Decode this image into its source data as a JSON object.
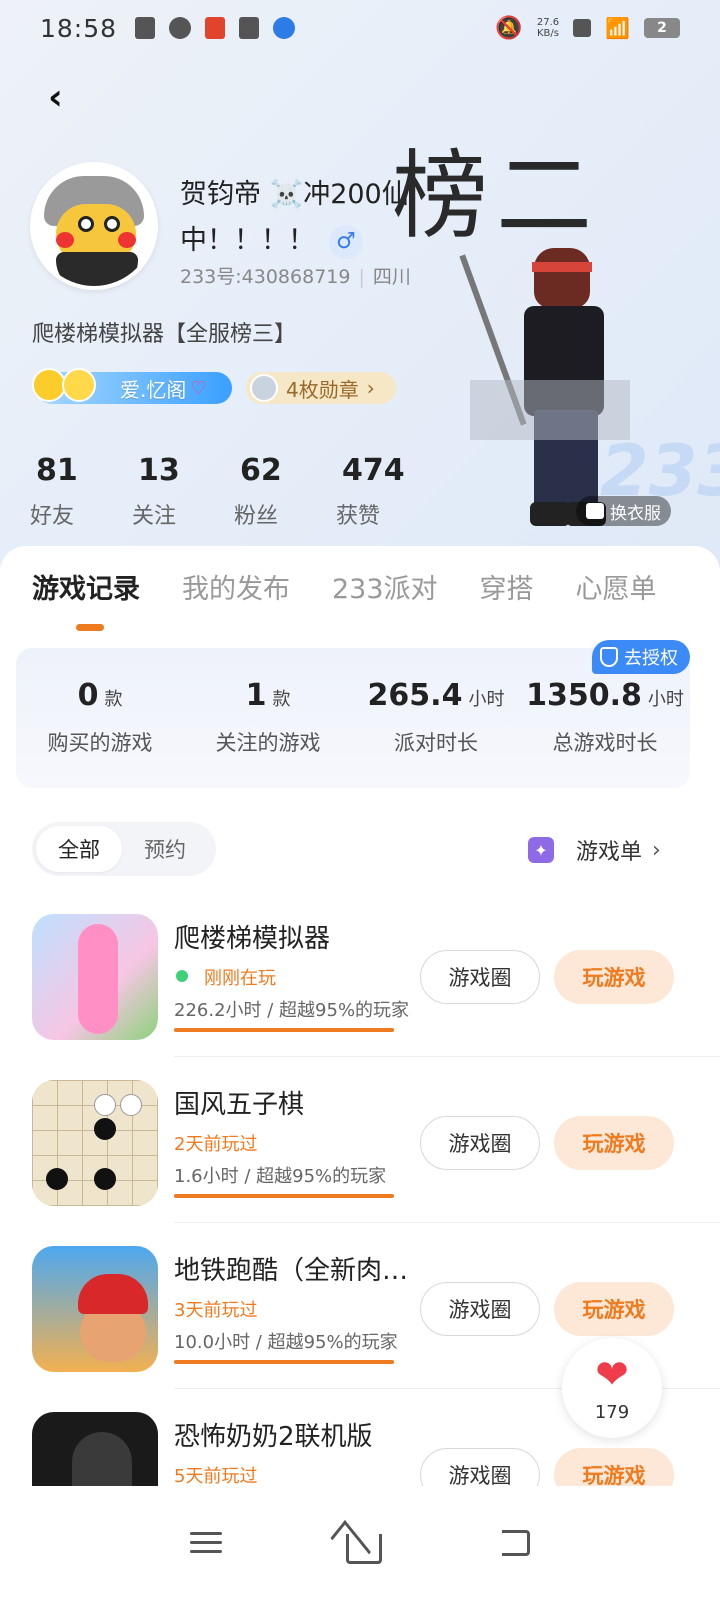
{
  "status_bar": {
    "time": "18:58",
    "net_speed_value": "27.6",
    "net_speed_unit": "KB/s",
    "battery": "2",
    "icons": [
      "sim-icon",
      "app-icon",
      "app-icon",
      "battery-icon",
      "telecom-icon",
      "mute-icon",
      "wifi-icon"
    ]
  },
  "profile": {
    "name": "贺钧帝 ☠️冲200仙中！！！！",
    "gender_symbol": "♂",
    "uid": "233号:430868719",
    "location": "四川",
    "big_overlay_text": "榜二",
    "bio": "爬楼梯模拟器【全服榜三】",
    "tag_label": "爱.忆阁",
    "tag_suffix": "♡",
    "medal_label": "4枚勋章",
    "stats": [
      {
        "value": "81",
        "label": "好友"
      },
      {
        "value": "13",
        "label": "关注"
      },
      {
        "value": "62",
        "label": "粉丝"
      },
      {
        "value": "474",
        "label": "获赞"
      }
    ],
    "change_outfit_label": "换衣服",
    "watermark_233": "233"
  },
  "tabs": [
    {
      "label": "游戏记录",
      "active": true
    },
    {
      "label": "我的发布",
      "active": false
    },
    {
      "label": "233派对",
      "active": false
    },
    {
      "label": "穿搭",
      "active": false
    },
    {
      "label": "心愿单",
      "active": false
    }
  ],
  "summary": {
    "auth_label": "去授权",
    "items": [
      {
        "value": "0",
        "unit": "款",
        "label": "购买的游戏"
      },
      {
        "value": "1",
        "unit": "款",
        "label": "关注的游戏"
      },
      {
        "value": "265.4",
        "unit": "小时",
        "label": "派对时长"
      },
      {
        "value": "1350.8",
        "unit": "小时",
        "label": "总游戏时长"
      }
    ]
  },
  "filters": [
    {
      "label": "全部",
      "active": true
    },
    {
      "label": "预约",
      "active": false
    }
  ],
  "gamelist_label": "游戏单",
  "games": [
    {
      "name": "爬楼梯模拟器",
      "status": "刚刚在玩",
      "live": true,
      "meta": "226.2小时 / 超越95%的玩家",
      "circle_label": "游戏圈",
      "play_label": "玩游戏"
    },
    {
      "name": "国风五子棋",
      "status": "2天前玩过",
      "live": false,
      "meta": "1.6小时 / 超越95%的玩家",
      "circle_label": "游戏圈",
      "play_label": "玩游戏"
    },
    {
      "name": "地铁跑酷（全新肉…",
      "status": "3天前玩过",
      "live": false,
      "meta": "10.0小时 / 超越95%的玩家",
      "circle_label": "游戏圈",
      "play_label": "玩游戏"
    },
    {
      "name": "恐怖奶奶2联机版",
      "status": "5天前玩过",
      "live": false,
      "meta": "",
      "circle_label": "游戏圈",
      "play_label": "玩游戏"
    }
  ],
  "like_fab": {
    "count": "179"
  },
  "colors": {
    "accent": "#f07a1e",
    "auth_blue": "#3c8af5",
    "like_red": "#ef3b4a"
  }
}
